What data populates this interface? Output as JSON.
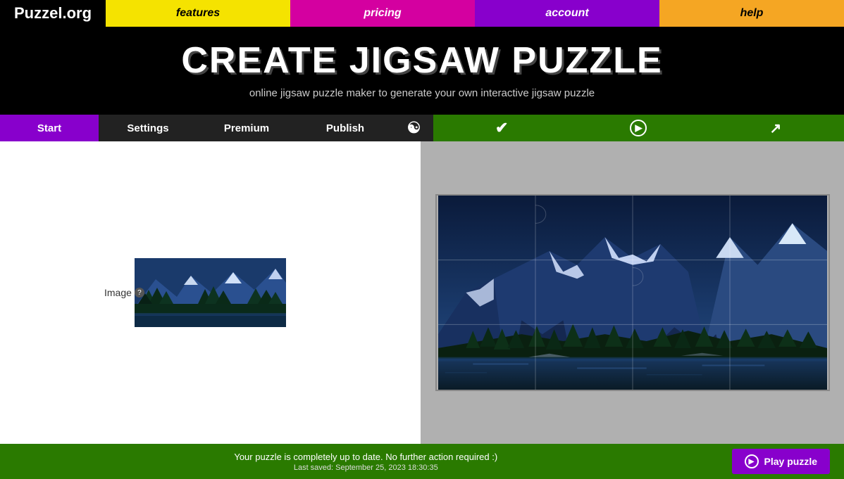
{
  "logo": "Puzzel.org",
  "nav": {
    "features": "features",
    "pricing": "pricing",
    "account": "account",
    "help": "help"
  },
  "hero": {
    "title": "CREATE JIGSAW PUZZLE",
    "subtitle": "online jigsaw puzzle maker to generate your own interactive jigsaw puzzle"
  },
  "tabs": {
    "start": "Start",
    "settings": "Settings",
    "premium": "Premium",
    "publish": "Publish",
    "yin_yang": "☯",
    "check": "✔",
    "play_circle": "▶",
    "share": "↗"
  },
  "left_panel": {
    "image_label": "Image",
    "help_icon": "?"
  },
  "bottom_bar": {
    "status_main": "Your puzzle is completely up to date. No further action required :)",
    "status_sub": "Last saved: September 25, 2023 18:30:35",
    "play_button": "Play puzzle"
  }
}
